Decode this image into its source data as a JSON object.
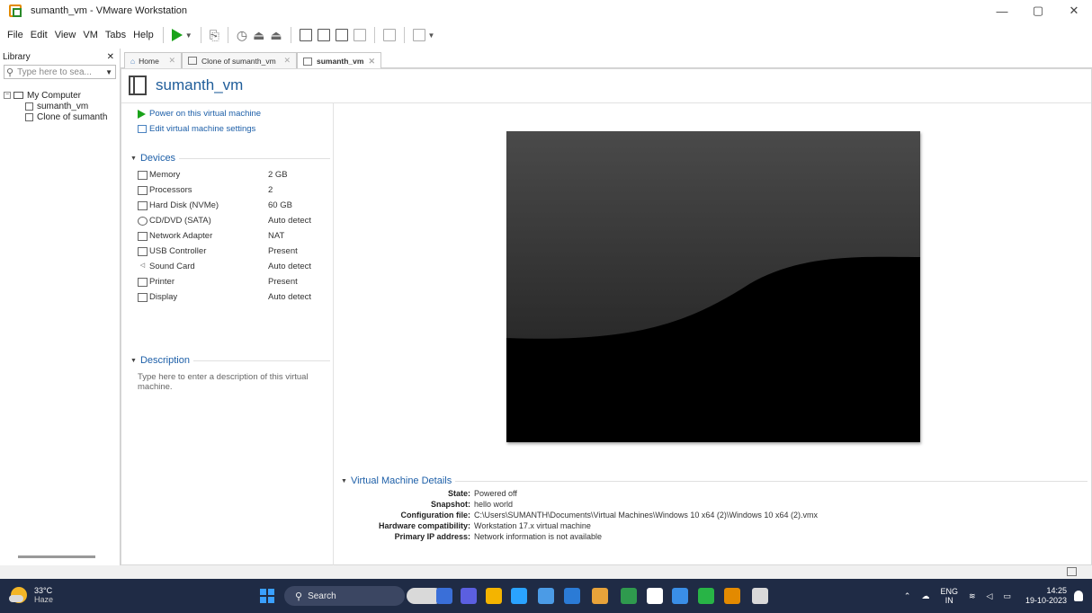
{
  "window": {
    "title": "sumanth_vm - VMware Workstation",
    "controls": {
      "minimize": "—",
      "maximize": "▢",
      "close": "✕"
    }
  },
  "menu": [
    "File",
    "Edit",
    "View",
    "VM",
    "Tabs",
    "Help"
  ],
  "library": {
    "title": "Library",
    "close": "✕",
    "search_placeholder": "Type here to sea...",
    "tree": {
      "root": "My Computer",
      "children": [
        "sumanth_vm",
        "Clone of sumanth"
      ]
    }
  },
  "tabs": [
    {
      "label": "Home",
      "close": "✕",
      "active": false
    },
    {
      "label": "Clone of sumanth_vm",
      "close": "✕",
      "active": false
    },
    {
      "label": "sumanth_vm",
      "close": "✕",
      "active": true
    }
  ],
  "vm": {
    "name": "sumanth_vm",
    "actions": {
      "power_on": "Power on this virtual machine",
      "edit_settings": "Edit virtual machine settings"
    },
    "devices_title": "Devices",
    "devices": [
      {
        "name": "Memory",
        "value": "2 GB",
        "icon": "memory-icon"
      },
      {
        "name": "Processors",
        "value": "2",
        "icon": "processor-icon"
      },
      {
        "name": "Hard Disk (NVMe)",
        "value": "60 GB",
        "icon": "hard-disk-icon"
      },
      {
        "name": "CD/DVD (SATA)",
        "value": "Auto detect",
        "icon": "cd-dvd-icon"
      },
      {
        "name": "Network Adapter",
        "value": "NAT",
        "icon": "network-adapter-icon"
      },
      {
        "name": "USB Controller",
        "value": "Present",
        "icon": "usb-icon"
      },
      {
        "name": "Sound Card",
        "value": "Auto detect",
        "icon": "sound-icon"
      },
      {
        "name": "Printer",
        "value": "Present",
        "icon": "printer-icon"
      },
      {
        "name": "Display",
        "value": "Auto detect",
        "icon": "display-icon"
      }
    ],
    "description_title": "Description",
    "description_placeholder": "Type here to enter a description of this virtual machine.",
    "details_title": "Virtual Machine Details",
    "details": [
      {
        "key": "State:",
        "value": "Powered off"
      },
      {
        "key": "Snapshot:",
        "value": "hello world"
      },
      {
        "key": "Configuration file:",
        "value": "C:\\Users\\SUMANTH\\Documents\\Virtual Machines\\Windows 10 x64 (2)\\Windows 10 x64 (2).vmx"
      },
      {
        "key": "Hardware compatibility:",
        "value": "Workstation 17.x virtual machine"
      },
      {
        "key": "Primary IP address:",
        "value": "Network information is not available"
      }
    ]
  },
  "taskbar": {
    "weather_temp": "33°C",
    "weather_desc": "Haze",
    "search": "Search",
    "lang_top": "ENG",
    "lang_bottom": "IN",
    "time": "14:25",
    "date": "19-10-2023",
    "app_colors": [
      "#d9d9d9",
      "#3a6fd8",
      "#5b5fe0",
      "#f4b400",
      "#2aa3ff",
      "#4b9be6",
      "#2b7bd6",
      "#e8a33a",
      "#2f9a4e",
      "#ffffff",
      "#3a8ee6",
      "#28b446",
      "#e38a00"
    ]
  }
}
